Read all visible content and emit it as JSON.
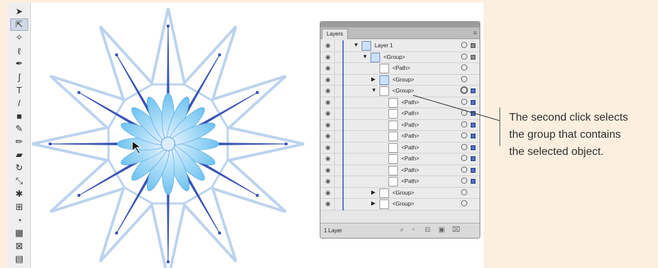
{
  "toolbar": {
    "tools": [
      {
        "icon": "selection-arrow-icon",
        "glyph": "➤"
      },
      {
        "icon": "group-selection-icon",
        "glyph": "⇱",
        "active": true
      },
      {
        "icon": "magic-wand-icon",
        "glyph": "✧"
      },
      {
        "icon": "lasso-icon",
        "glyph": "ℓ"
      },
      {
        "icon": "pen-icon",
        "glyph": "✒"
      },
      {
        "icon": "curvature-icon",
        "glyph": "∫"
      },
      {
        "icon": "type-icon",
        "glyph": "T"
      },
      {
        "icon": "line-icon",
        "glyph": "/"
      },
      {
        "icon": "rectangle-icon",
        "glyph": "■"
      },
      {
        "icon": "paintbrush-icon",
        "glyph": "✎"
      },
      {
        "icon": "pencil-icon",
        "glyph": "✏"
      },
      {
        "icon": "eraser-icon",
        "glyph": "▰"
      },
      {
        "icon": "rotate-icon",
        "glyph": "↻"
      },
      {
        "icon": "scale-icon",
        "glyph": "⤡"
      },
      {
        "icon": "puppet-warp-icon",
        "glyph": "✱"
      },
      {
        "icon": "free-transform-icon",
        "glyph": "⊞"
      },
      {
        "icon": "shape-builder-icon",
        "glyph": "◔"
      },
      {
        "icon": "perspective-grid-icon",
        "glyph": "▦"
      },
      {
        "icon": "mesh-icon",
        "glyph": "⊠"
      },
      {
        "icon": "gradient-icon",
        "glyph": "▤"
      }
    ]
  },
  "layers_panel": {
    "tab_label": "Layers",
    "footer_count": "1 Layer",
    "rows": [
      {
        "label": "Layer 1",
        "indent": 1,
        "arrow": "down",
        "thumb": "blue",
        "target": "normal",
        "select": "grey"
      },
      {
        "label": "<Group>",
        "indent": 2,
        "arrow": "down",
        "thumb": "blue",
        "target": "normal",
        "select": "grey"
      },
      {
        "label": "<Path>",
        "indent": 3,
        "arrow": "",
        "thumb": "white",
        "target": "normal",
        "select": ""
      },
      {
        "label": "<Group>",
        "indent": 3,
        "arrow": "right",
        "thumb": "blue",
        "target": "normal",
        "select": ""
      },
      {
        "label": "<Group>",
        "indent": 3,
        "arrow": "down",
        "thumb": "white",
        "target": "big",
        "select": "blue"
      },
      {
        "label": "<Path>",
        "indent": 4,
        "arrow": "",
        "thumb": "white",
        "target": "normal",
        "select": "blue"
      },
      {
        "label": "<Path>",
        "indent": 4,
        "arrow": "",
        "thumb": "white",
        "target": "normal",
        "select": "blue"
      },
      {
        "label": "<Path>",
        "indent": 4,
        "arrow": "",
        "thumb": "white",
        "target": "normal",
        "select": "blue"
      },
      {
        "label": "<Path>",
        "indent": 4,
        "arrow": "",
        "thumb": "white",
        "target": "normal",
        "select": "blue"
      },
      {
        "label": "<Path>",
        "indent": 4,
        "arrow": "",
        "thumb": "white",
        "target": "normal",
        "select": "blue"
      },
      {
        "label": "<Path>",
        "indent": 4,
        "arrow": "",
        "thumb": "white",
        "target": "normal",
        "select": "blue"
      },
      {
        "label": "<Path>",
        "indent": 4,
        "arrow": "",
        "thumb": "white",
        "target": "normal",
        "select": "blue"
      },
      {
        "label": "<Path>",
        "indent": 4,
        "arrow": "",
        "thumb": "white",
        "target": "normal",
        "select": "blue"
      },
      {
        "label": "<Group>",
        "indent": 3,
        "arrow": "right",
        "thumb": "white",
        "target": "normal",
        "select": ""
      },
      {
        "label": "<Group>",
        "indent": 3,
        "arrow": "right",
        "thumb": "white",
        "target": "normal",
        "select": ""
      }
    ]
  },
  "callout": {
    "lines": [
      "The second click selects",
      "the group that contains",
      "the selected object."
    ]
  },
  "colors": {
    "page_background": "#fcefe0",
    "star_outline": "#bcd3ee",
    "spike_dark": "#3a55b5",
    "petal_light": "#6cc3f0",
    "selection_blue": "#4f6fc4"
  }
}
